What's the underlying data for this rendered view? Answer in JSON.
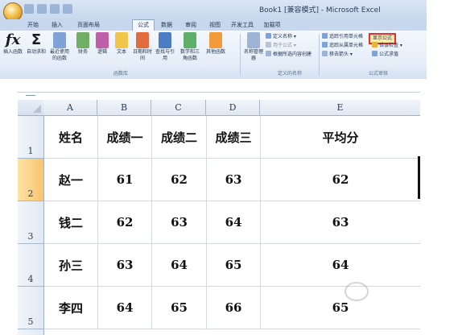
{
  "window": {
    "title": "Book1  [兼容模式] - Microsoft Excel"
  },
  "tabs": [
    "开始",
    "插入",
    "页面布局",
    "公式",
    "数据",
    "审阅",
    "视图",
    "开发工具",
    "加载项"
  ],
  "active_tab": "公式",
  "ribbon": {
    "insert_function": "插入函数",
    "autosum": "自动求和",
    "recent": "最近使用的函数",
    "financial": "财务",
    "logical": "逻辑",
    "text": "文本",
    "datetime": "日期和时间",
    "lookup": "查找与引用",
    "math": "数学和三角函数",
    "other": "其他函数",
    "library_label": "函数库",
    "name_manager": "名称管理器",
    "define_name": "定义名称",
    "use_in_formula": "用于公式",
    "create_from_selection": "根据所选内容创建",
    "names_label": "定义的名称",
    "trace_precedents": "追踪引用单元格",
    "trace_dependents": "追踪从属单元格",
    "remove_arrows": "移去箭头",
    "show_formulas": "显示公式",
    "error_checking": "错误检查",
    "evaluate_formula": "公式求值",
    "audit_label": "公式审核",
    "colors": {
      "highlight_border": "#e53030",
      "ribbon_bg": "#e3ecf7"
    }
  },
  "sheet": {
    "columns": [
      "A",
      "B",
      "C",
      "D",
      "E"
    ],
    "rows": [
      "1",
      "2",
      "3",
      "4",
      "5"
    ],
    "selected_row": "2",
    "header": [
      "姓名",
      "成绩一",
      "成绩二",
      "成绩三",
      "平均分"
    ],
    "data": [
      [
        "赵一",
        "61",
        "62",
        "63",
        "62"
      ],
      [
        "钱二",
        "62",
        "63",
        "64",
        "63"
      ],
      [
        "孙三",
        "63",
        "64",
        "65",
        "64"
      ],
      [
        "李四",
        "64",
        "65",
        "66",
        "65"
      ]
    ]
  }
}
